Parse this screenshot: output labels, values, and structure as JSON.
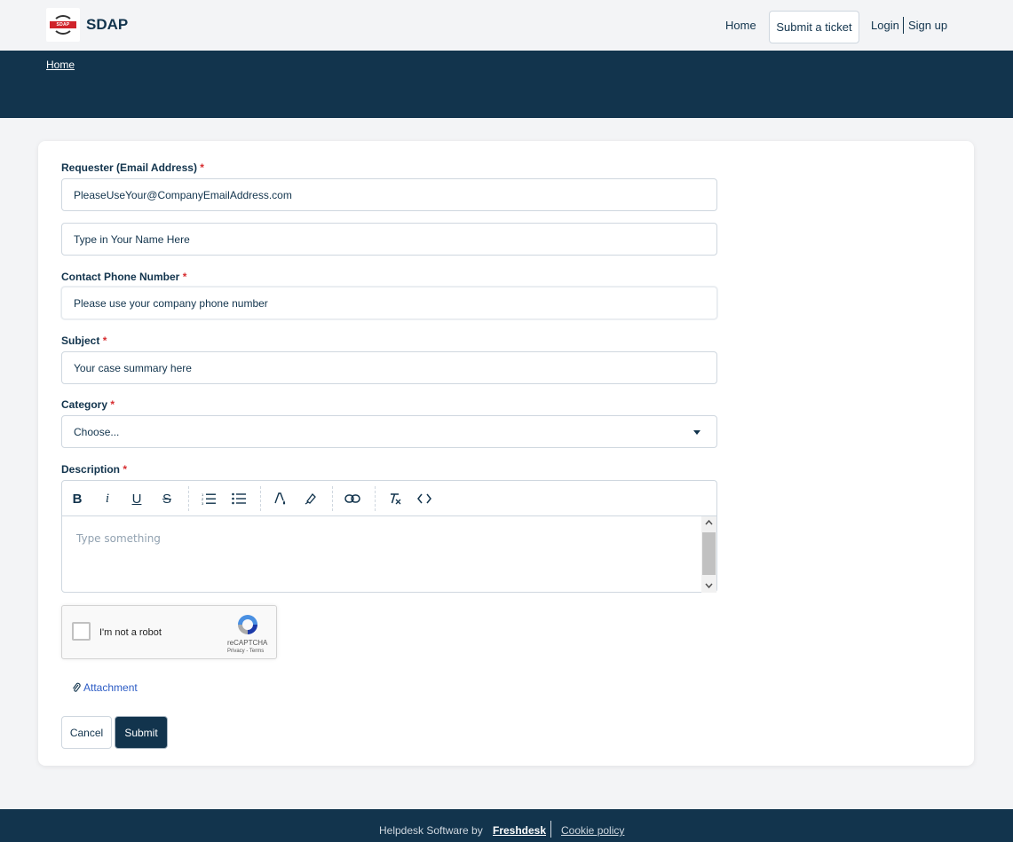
{
  "header": {
    "logo_text": "SDAP",
    "brand": "SDAP",
    "nav": {
      "home": "Home",
      "submit_ticket": "Submit a ticket",
      "login": "Login",
      "signup": "Sign up"
    }
  },
  "banner": {
    "breadcrumb": "Home"
  },
  "form": {
    "requester_label": "Requester (Email Address)",
    "requester_value": "PleaseUseYour@CompanyEmailAddress.com",
    "name_value": "Type in Your Name Here",
    "phone_label": "Contact Phone Number",
    "phone_value": "Please use your company phone number",
    "subject_label": "Subject",
    "subject_value": "Your case summary here",
    "category_label": "Category",
    "category_value": "Choose...",
    "description_label": "Description",
    "description_placeholder": "Type something",
    "required_mark": "*",
    "toolbar": [
      "bold-icon",
      "italic-icon",
      "underline-icon",
      "strikethrough-icon",
      "numbered-list-icon",
      "bulleted-list-icon",
      "font-color-icon",
      "highlight-icon",
      "link-icon",
      "clear-format-icon",
      "code-icon"
    ],
    "captcha": {
      "label": "I'm not a robot",
      "brand": "reCAPTCHA",
      "terms": "Privacy - Terms"
    },
    "attachment": "Attachment",
    "cancel": "Cancel",
    "submit": "Submit"
  },
  "footer": {
    "prefix": "Helpdesk Software by",
    "link": "Freshdesk",
    "cookie": "Cookie policy"
  },
  "colors": {
    "primary": "#12344d",
    "required": "#d72d30",
    "link": "#2c5cc5",
    "background": "#f3f4f6"
  }
}
